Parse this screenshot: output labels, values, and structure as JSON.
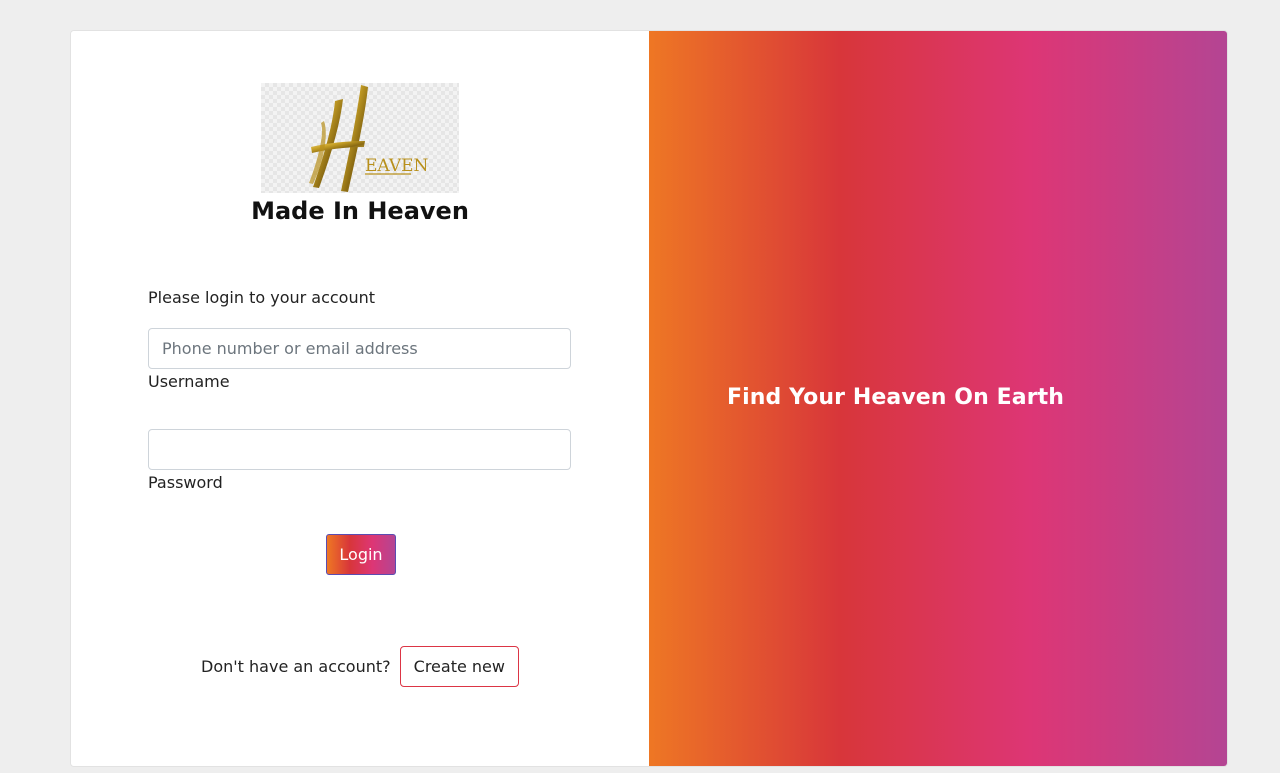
{
  "brand": {
    "logo_text": "EAVEN",
    "title": "Made In Heaven"
  },
  "form": {
    "prompt": "Please login to your account",
    "username": {
      "placeholder": "Phone number or email address",
      "value": "",
      "label": "Username"
    },
    "password": {
      "placeholder": "",
      "value": "",
      "label": "Password"
    },
    "login_label": "Login"
  },
  "signup": {
    "text": "Don't have an account?",
    "button_label": "Create new"
  },
  "hero": {
    "tagline": "Find Your Heaven On Earth"
  },
  "colors": {
    "gradient": [
      "#ee7724",
      "#d8363a",
      "#dd3675",
      "#b44593"
    ],
    "page_background": "#eeeeee",
    "create_border": "#dc3545",
    "logo_gold": "#c9a227"
  },
  "icons": {
    "logo": "heaven-logo-icon"
  }
}
